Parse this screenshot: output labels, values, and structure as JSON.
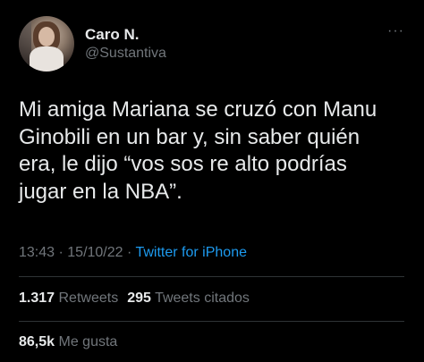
{
  "tweet": {
    "author": {
      "display_name": "Caro N.",
      "handle": "@Sustantiva",
      "avatar_icon": "profile-photo"
    },
    "more_icon": "ellipsis-icon",
    "more_label": "···",
    "text": "Mi amiga Mariana se cruzó con Manu\nGinobili en un bar y, sin saber quién\nera, le dijo “vos sos re alto podrías\njugar en la NBA”.",
    "time": "13:43",
    "separator1": " · ",
    "date": "15/10/22",
    "separator2": " · ",
    "source": "Twitter for iPhone",
    "retweets_count": "1.317",
    "retweets_label": "Retweets",
    "quotes_count": "295",
    "quotes_label": "Tweets citados",
    "likes_count": "86,5k",
    "likes_label": "Me gusta"
  },
  "colors": {
    "background": "#000000",
    "text_primary": "#e7e9ea",
    "text_secondary": "#71767b",
    "link": "#1d9bf0",
    "divider": "#2f3336"
  }
}
